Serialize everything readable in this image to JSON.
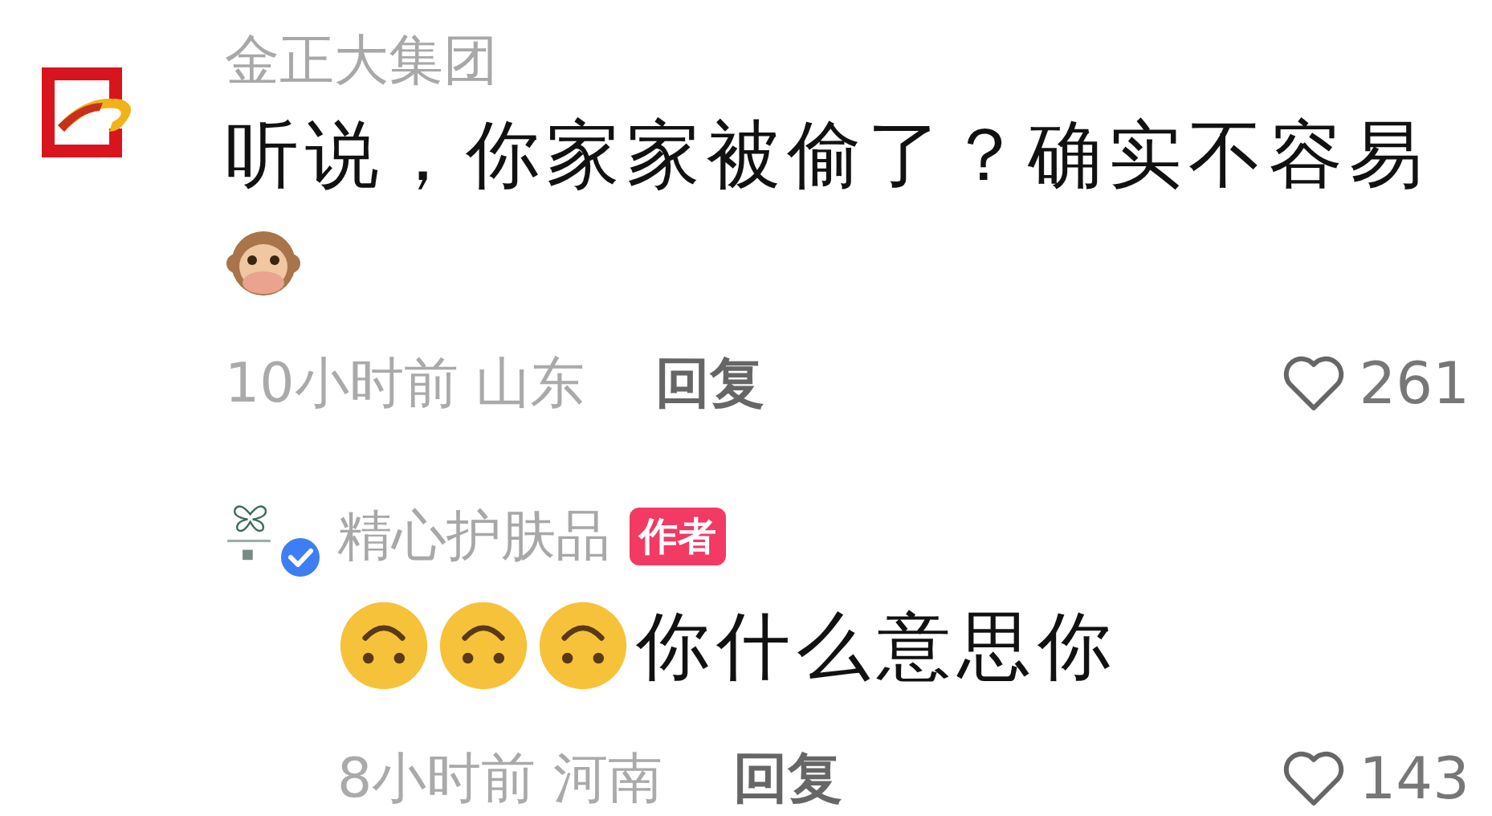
{
  "comments": [
    {
      "author": "金正大集团",
      "avatar": {
        "kind": "logo"
      },
      "text": "听说，你家家被偷了？确实不容易",
      "trail_emojis": [
        {
          "kind": "monkey"
        }
      ],
      "time": "10小时前",
      "region": "山东",
      "reply_label": "回复",
      "likes": "261",
      "liked": false,
      "replies": [
        {
          "author": "精心护肤品",
          "avatar": {
            "kind": "butterfly"
          },
          "verified": true,
          "badge": "作者",
          "lead_emojis": [
            {
              "kind": "upside-down"
            },
            {
              "kind": "upside-down"
            },
            {
              "kind": "upside-down"
            }
          ],
          "text": "你什么意思你",
          "time": "8小时前",
          "region": "河南",
          "reply_label": "回复",
          "likes": "143",
          "liked": false
        }
      ]
    }
  ]
}
